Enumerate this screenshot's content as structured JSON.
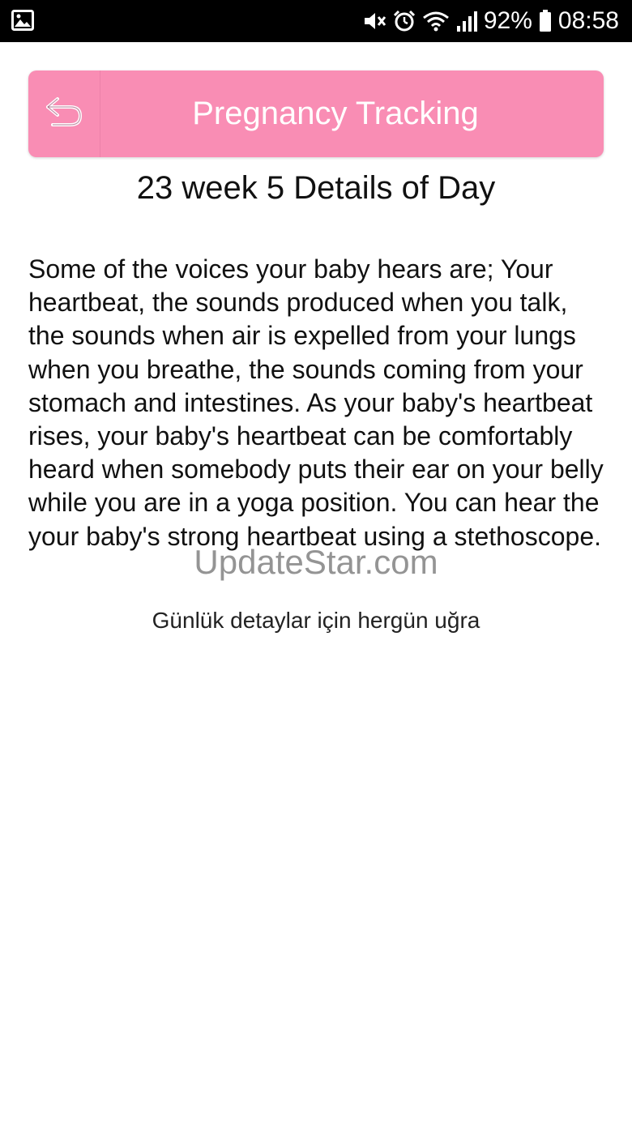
{
  "status_bar": {
    "battery": "92%",
    "time": "08:58",
    "icons": [
      "image-notification-icon",
      "mute-icon",
      "alarm-icon",
      "wifi-icon",
      "signal-icon",
      "battery-icon"
    ]
  },
  "header": {
    "title": "Pregnancy Tracking",
    "back_icon": "back-arrow-icon",
    "color": "#f98db4"
  },
  "main": {
    "heading": "23 week 5 Details of Day",
    "body": "Some of the voices your baby hears are; Your heartbeat, the sounds produced when you talk, the sounds when air is expelled from your lungs when you breathe, the sounds coming from your stomach and intestines. As your baby's heartbeat rises, your baby's heartbeat can be comfortably heard when somebody puts their ear on your belly while you are in a yoga position. You can hear the your baby's strong heartbeat using a stethoscope.",
    "footer_note": "Günlük detaylar için hergün uğra"
  },
  "watermark": {
    "text": "UpdateStar.com"
  }
}
